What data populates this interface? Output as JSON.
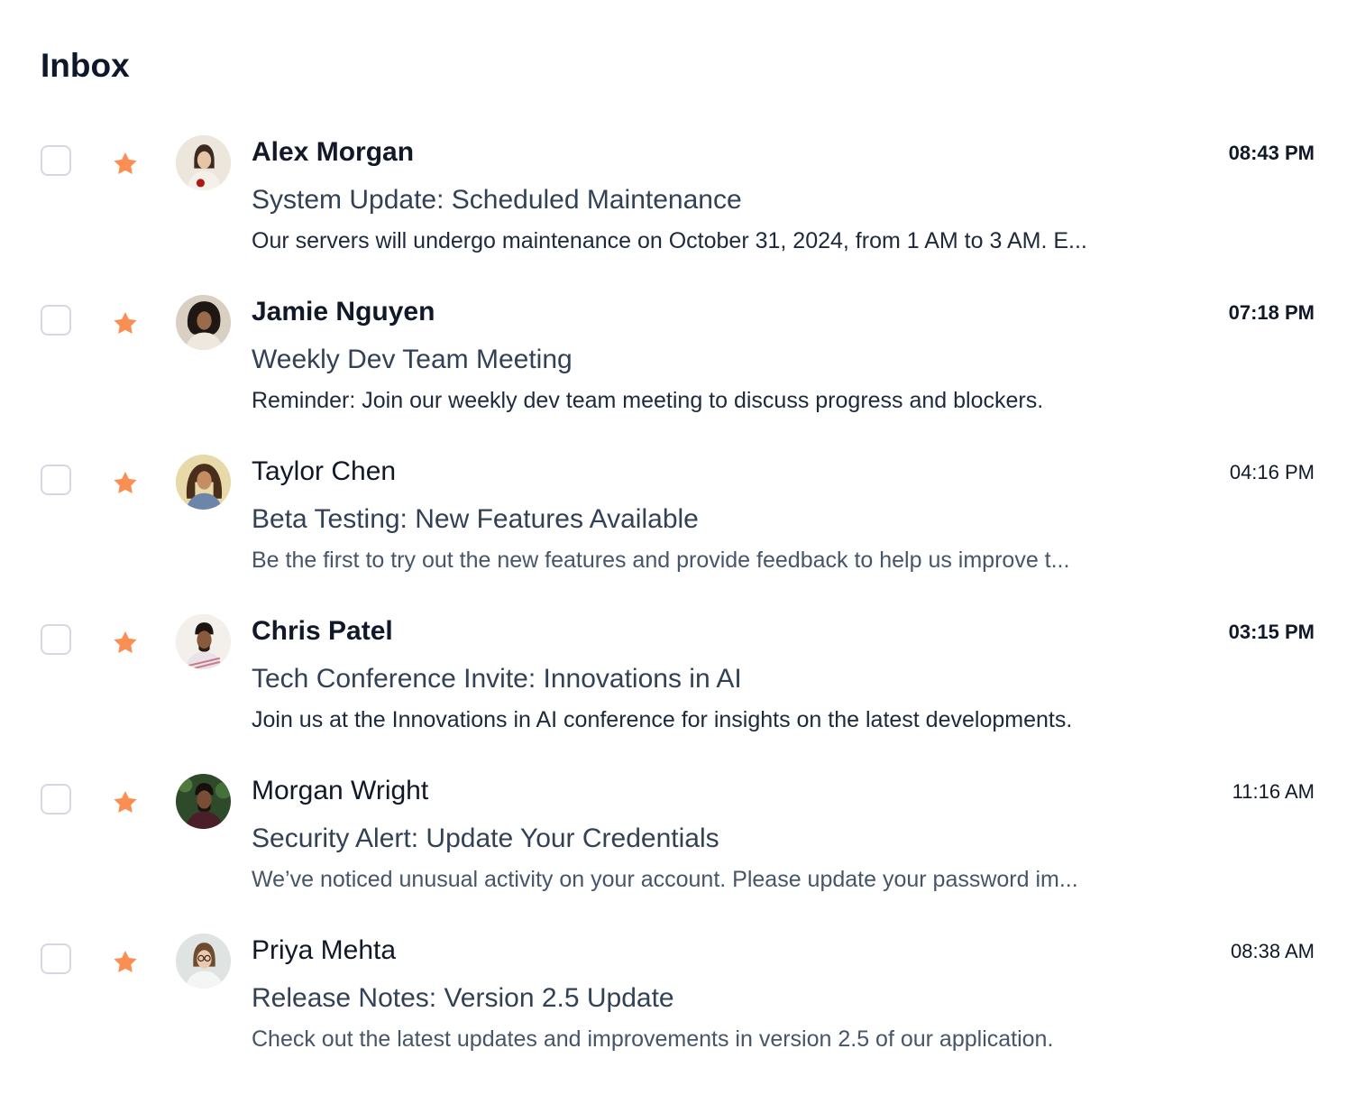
{
  "page": {
    "title": "Inbox"
  },
  "colors": {
    "star": "#fb8f53",
    "checkbox_border": "#d5d8e2",
    "sender_text": "#111827",
    "subject_text": "#334155",
    "preview_text_unread": "#1e293b",
    "preview_text_read": "#475569"
  },
  "emails": [
    {
      "sender": "Alex Morgan",
      "subject": "System Update: Scheduled Maintenance",
      "preview": "Our servers will undergo maintenance on October 31, 2024, from 1 AM to 3 AM. E...",
      "time": "08:43 PM",
      "unread": true,
      "starred": true,
      "selected": false,
      "avatar_icon": "avatar-photo"
    },
    {
      "sender": "Jamie Nguyen",
      "subject": "Weekly Dev Team Meeting",
      "preview": "Reminder: Join our weekly dev team meeting to discuss progress and blockers.",
      "time": "07:18 PM",
      "unread": true,
      "starred": true,
      "selected": false,
      "avatar_icon": "avatar-photo"
    },
    {
      "sender": "Taylor Chen",
      "subject": "Beta Testing: New Features Available",
      "preview": "Be the first to try out the new features and provide feedback to help us improve t...",
      "time": "04:16 PM",
      "unread": false,
      "starred": true,
      "selected": false,
      "avatar_icon": "avatar-photo"
    },
    {
      "sender": "Chris Patel",
      "subject": "Tech Conference Invite: Innovations in AI",
      "preview": "Join us at the Innovations in AI conference for insights on the latest developments.",
      "time": "03:15 PM",
      "unread": true,
      "starred": true,
      "selected": false,
      "avatar_icon": "avatar-photo"
    },
    {
      "sender": "Morgan Wright",
      "subject": "Security Alert: Update Your Credentials",
      "preview": "We’ve noticed unusual activity on your account. Please update your password im...",
      "time": "11:16 AM",
      "unread": false,
      "starred": true,
      "selected": false,
      "avatar_icon": "avatar-photo"
    },
    {
      "sender": "Priya Mehta",
      "subject": "Release Notes: Version 2.5 Update",
      "preview": "Check out the latest updates and improvements in version 2.5 of our application.",
      "time": "08:38 AM",
      "unread": false,
      "starred": true,
      "selected": false,
      "avatar_icon": "avatar-photo"
    }
  ]
}
